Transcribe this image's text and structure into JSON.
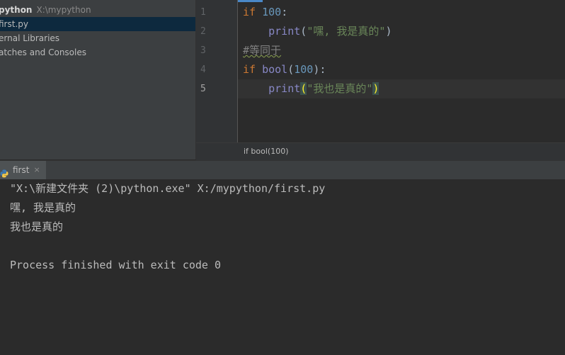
{
  "project_panel": {
    "root_name": "python",
    "root_path": "X:\\mypython",
    "selected_file": "first.py",
    "external_libraries": "ernal Libraries",
    "scratches": "atches and Consoles"
  },
  "editor": {
    "line_numbers": [
      "1",
      "2",
      "3",
      "4",
      "5"
    ],
    "current_line": 5,
    "lines": [
      [
        {
          "t": "if ",
          "c": "kw"
        },
        {
          "t": "100",
          "c": "num"
        },
        {
          "t": ":",
          "c": ""
        }
      ],
      [
        {
          "t": "    ",
          "c": ""
        },
        {
          "t": "print",
          "c": "builtin"
        },
        {
          "t": "(",
          "c": ""
        },
        {
          "t": "\"嘿, 我是真的\"",
          "c": "str"
        },
        {
          "t": ")",
          "c": ""
        }
      ],
      [
        {
          "t": "#等同于",
          "c": "cmt"
        }
      ],
      [
        {
          "t": "if ",
          "c": "kw"
        },
        {
          "t": "bool",
          "c": "builtin"
        },
        {
          "t": "(",
          "c": ""
        },
        {
          "t": "100",
          "c": "num"
        },
        {
          "t": "):",
          "c": ""
        }
      ],
      [
        {
          "t": "    ",
          "c": ""
        },
        {
          "t": "print",
          "c": "builtin"
        },
        {
          "t": "(",
          "c": "brace-match"
        },
        {
          "t": "\"我也是真的\"",
          "c": "str"
        },
        {
          "t": ")",
          "c": "brace-match"
        }
      ]
    ],
    "breadcrumb": "if bool(100)"
  },
  "run_window": {
    "tab_label": "first",
    "tab_close": "×",
    "console_lines": [
      "\"X:\\新建文件夹 (2)\\python.exe\" X:/mypython/first.py",
      "嘿, 我是真的",
      "我也是真的",
      "",
      "Process finished with exit code 0"
    ]
  },
  "icons": {
    "run_tab_icon": "python-icon"
  },
  "colors": {
    "keyword": "#cc7832",
    "number": "#6897bb",
    "string": "#6a8759",
    "builtin": "#8888c6",
    "comment": "#808080",
    "selection": "#0d293e"
  }
}
